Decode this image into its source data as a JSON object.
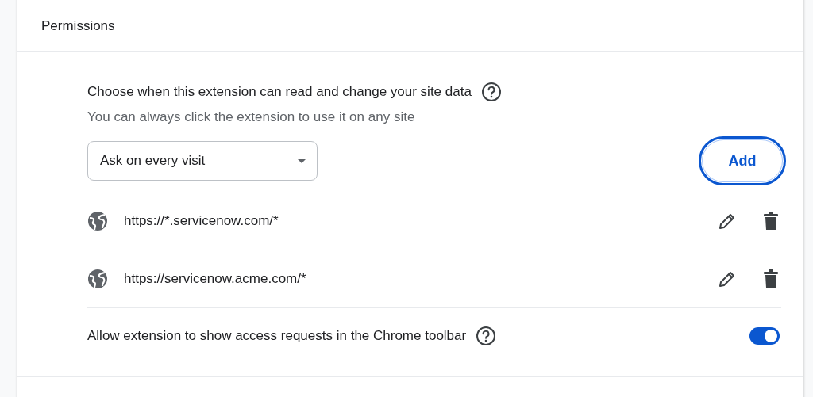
{
  "section": {
    "title": "Permissions"
  },
  "site_access": {
    "heading": "Choose when this extension can read and change your site data",
    "description": "You can always click the extension to use it on any site",
    "dropdown": {
      "value": "Ask on every visit"
    },
    "add_button": {
      "label": "Add",
      "focused": true
    }
  },
  "sites": [
    {
      "url": "https://*.servicenow.com/*"
    },
    {
      "url": "https://servicenow.acme.com/*"
    }
  ],
  "toolbar_setting": {
    "label": "Allow extension to show access requests in the Chrome toolbar",
    "on": true
  }
}
